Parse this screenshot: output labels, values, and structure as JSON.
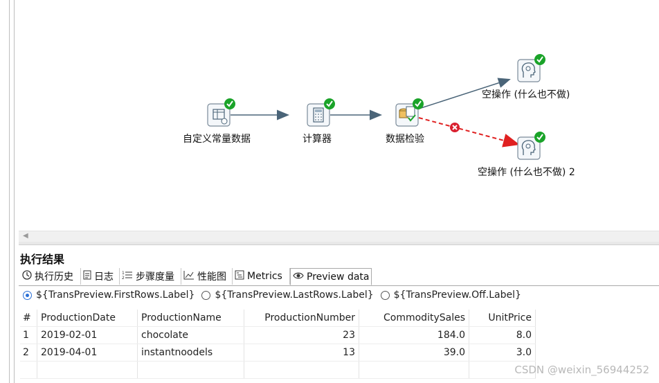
{
  "canvas": {
    "nodes": [
      {
        "id": "const",
        "label": "自定义常量数据",
        "icon": "table-gear-icon",
        "status": "ok"
      },
      {
        "id": "calc",
        "label": "计算器",
        "icon": "calculator-icon",
        "status": "ok"
      },
      {
        "id": "validate",
        "label": "数据检验",
        "icon": "database-check-icon",
        "status": "ok"
      },
      {
        "id": "dummy1",
        "label": "空操作 (什么也不做)",
        "icon": "head-gear-icon",
        "status": "ok"
      },
      {
        "id": "dummy2",
        "label": "空操作 (什么也不做) 2",
        "icon": "head-gear-icon",
        "status": "ok"
      }
    ],
    "hops": [
      {
        "from": "const",
        "to": "calc",
        "type": "normal"
      },
      {
        "from": "calc",
        "to": "validate",
        "type": "normal"
      },
      {
        "from": "validate",
        "to": "dummy1",
        "type": "normal"
      },
      {
        "from": "validate",
        "to": "dummy2",
        "type": "error"
      }
    ]
  },
  "results": {
    "title": "执行结果",
    "tabs": [
      {
        "label": "执行历史",
        "icon": "clock-icon"
      },
      {
        "label": "日志",
        "icon": "log-icon"
      },
      {
        "label": "步骤度量",
        "icon": "list-numbers-icon"
      },
      {
        "label": "性能图",
        "icon": "chart-icon"
      },
      {
        "label": "Metrics",
        "icon": "metrics-icon"
      },
      {
        "label": "Preview data",
        "icon": "eye-icon",
        "active": true
      }
    ],
    "radios": [
      {
        "label": "${TransPreview.FirstRows.Label}",
        "checked": true
      },
      {
        "label": "${TransPreview.LastRows.Label}",
        "checked": false
      },
      {
        "label": "${TransPreview.Off.Label}",
        "checked": false
      }
    ],
    "table": {
      "columns": [
        "#",
        "ProductionDate",
        "ProductionName",
        "ProductionNumber",
        "CommoditySales",
        "UnitPrice"
      ],
      "rows": [
        [
          "1",
          "2019-02-01",
          "chocolate",
          "23",
          "184.0",
          "8.0"
        ],
        [
          "2",
          "2019-04-01",
          "instantnoodels",
          "13",
          "39.0",
          "3.0"
        ]
      ]
    }
  },
  "watermark": "CSDN @weixin_56944252",
  "colors": {
    "ok_badge": "#1aa329",
    "hop": "#4a6478",
    "error_hop": "#e02020",
    "radio_accent": "#2a6fd6"
  }
}
